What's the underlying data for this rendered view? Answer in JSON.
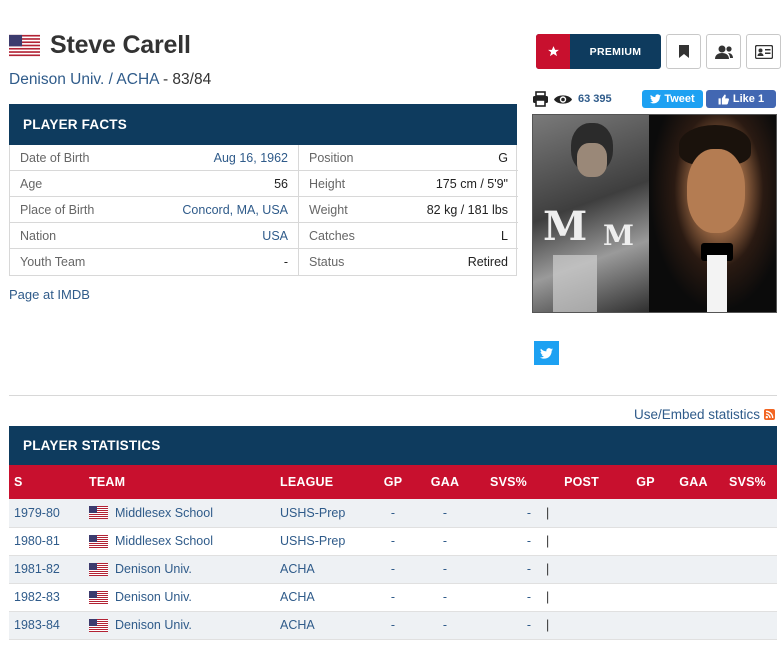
{
  "player": {
    "name": "Steve Carell",
    "team": "Denison Univ.",
    "separator": " / ",
    "league": "ACHA",
    "draft_suffix": " - 83/84"
  },
  "top_buttons": {
    "premium_label": "PREMIUM",
    "icons": [
      "star-icon",
      "bookmark-icon",
      "users-icon",
      "id-card-icon"
    ]
  },
  "social": {
    "views": "63 395",
    "tweet_label": "Tweet",
    "like_label": "Like 1"
  },
  "player_facts": {
    "title": "PLAYER FACTS",
    "left": [
      {
        "label": "Date of Birth",
        "value": "Aug 16, 1962",
        "link": true
      },
      {
        "label": "Age",
        "value": "56",
        "link": false
      },
      {
        "label": "Place of Birth",
        "value": "Concord, MA, USA",
        "link": true
      },
      {
        "label": "Nation",
        "value": "USA",
        "link": true
      },
      {
        "label": "Youth Team",
        "value": "-",
        "link": false
      }
    ],
    "right": [
      {
        "label": "Position",
        "value": "G"
      },
      {
        "label": "Height",
        "value": "175 cm / 5'9\""
      },
      {
        "label": "Weight",
        "value": "82 kg / 181 lbs"
      },
      {
        "label": "Catches",
        "value": "L"
      },
      {
        "label": "Status",
        "value": "Retired"
      }
    ]
  },
  "imdb_link": "Page at IMDB",
  "embed_link": "Use/Embed statistics",
  "player_stats": {
    "title": "PLAYER STATISTICS",
    "headers": [
      "S",
      "TEAM",
      "LEAGUE",
      "GP",
      "GAA",
      "SVS%",
      "POST",
      "GP",
      "GAA",
      "SVS%"
    ],
    "rows": [
      {
        "season": "1979-80",
        "team": "Middlesex School",
        "league": "USHS-Prep",
        "gp": "-",
        "gaa": "-",
        "svs": "-",
        "sep": "|"
      },
      {
        "season": "1980-81",
        "team": "Middlesex School",
        "league": "USHS-Prep",
        "gp": "-",
        "gaa": "-",
        "svs": "-",
        "sep": "|"
      },
      {
        "season": "1981-82",
        "team": "Denison Univ.",
        "league": "ACHA",
        "gp": "-",
        "gaa": "-",
        "svs": "-",
        "sep": "|"
      },
      {
        "season": "1982-83",
        "team": "Denison Univ.",
        "league": "ACHA",
        "gp": "-",
        "gaa": "-",
        "svs": "-",
        "sep": "|"
      },
      {
        "season": "1983-84",
        "team": "Denison Univ.",
        "league": "ACHA",
        "gp": "-",
        "gaa": "-",
        "svs": "-",
        "sep": "|"
      }
    ]
  },
  "colors": {
    "navy": "#0e3b5e",
    "red": "#c8102e",
    "link": "#2f5b8a"
  }
}
